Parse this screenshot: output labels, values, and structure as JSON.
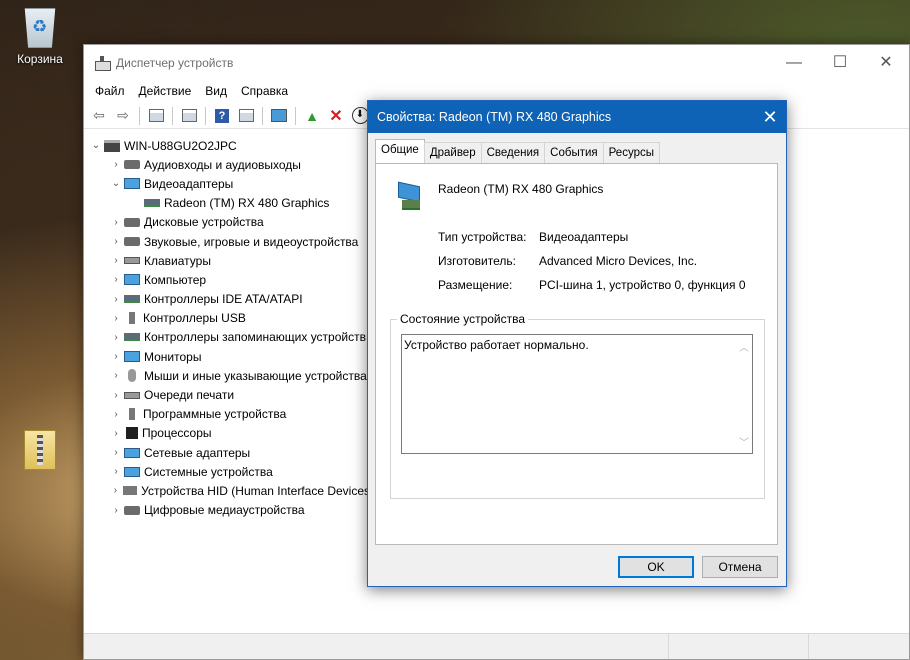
{
  "desktop": {
    "recycle_label": "Корзина"
  },
  "device_manager": {
    "title": "Диспетчер устройств",
    "controls": {
      "minimize": "—",
      "maximize": "☐",
      "close": "✕"
    },
    "menu": [
      "Файл",
      "Действие",
      "Вид",
      "Справка"
    ],
    "tree": {
      "root": "WIN-U88GU2O2JPC",
      "items": [
        {
          "label": "Аудиовходы и аудиовыходы",
          "expanded": false,
          "icon": "speaker-icon"
        },
        {
          "label": "Видеоадаптеры",
          "expanded": true,
          "icon": "display-adapter-icon",
          "children": [
            "Radeon (TM) RX 480 Graphics"
          ]
        },
        {
          "label": "Дисковые устройства",
          "expanded": false,
          "icon": "disk-drive-icon"
        },
        {
          "label": "Звуковые, игровые и видеоустройства",
          "expanded": false,
          "icon": "sound-icon"
        },
        {
          "label": "Клавиатуры",
          "expanded": false,
          "icon": "keyboard-icon"
        },
        {
          "label": "Компьютер",
          "expanded": false,
          "icon": "computer-icon"
        },
        {
          "label": "Контроллеры IDE ATA/ATAPI",
          "expanded": false,
          "icon": "ide-controller-icon"
        },
        {
          "label": "Контроллеры USB",
          "expanded": false,
          "icon": "usb-icon"
        },
        {
          "label": "Контроллеры запоминающих устройств",
          "expanded": false,
          "icon": "storage-controller-icon"
        },
        {
          "label": "Мониторы",
          "expanded": false,
          "icon": "monitor-icon"
        },
        {
          "label": "Мыши и иные указывающие устройства",
          "expanded": false,
          "icon": "mouse-icon"
        },
        {
          "label": "Очереди печати",
          "expanded": false,
          "icon": "printer-icon"
        },
        {
          "label": "Программные устройства",
          "expanded": false,
          "icon": "software-device-icon"
        },
        {
          "label": "Процессоры",
          "expanded": false,
          "icon": "processor-icon"
        },
        {
          "label": "Сетевые адаптеры",
          "expanded": false,
          "icon": "network-adapter-icon"
        },
        {
          "label": "Системные устройства",
          "expanded": false,
          "icon": "system-device-icon"
        },
        {
          "label": "Устройства HID (Human Interface Devices)",
          "expanded": false,
          "icon": "hid-icon"
        },
        {
          "label": "Цифровые медиаустройства",
          "expanded": false,
          "icon": "media-device-icon"
        }
      ]
    }
  },
  "dialog": {
    "title": "Свойства: Radeon (TM) RX 480 Graphics",
    "close": "✕",
    "tabs": [
      "Общие",
      "Драйвер",
      "Сведения",
      "События",
      "Ресурсы"
    ],
    "active_tab": "Общие",
    "device_name": "Radeon (TM) RX 480 Graphics",
    "properties": [
      {
        "label": "Тип устройства:",
        "value": "Видеоадаптеры"
      },
      {
        "label": "Изготовитель:",
        "value": "Advanced Micro Devices, Inc."
      },
      {
        "label": "Размещение:",
        "value": "PCI-шина 1, устройство 0, функция 0"
      }
    ],
    "status_group_label": "Состояние устройства",
    "status_text": "Устройство работает нормально.",
    "ok_label": "OK",
    "cancel_label": "Отмена"
  }
}
